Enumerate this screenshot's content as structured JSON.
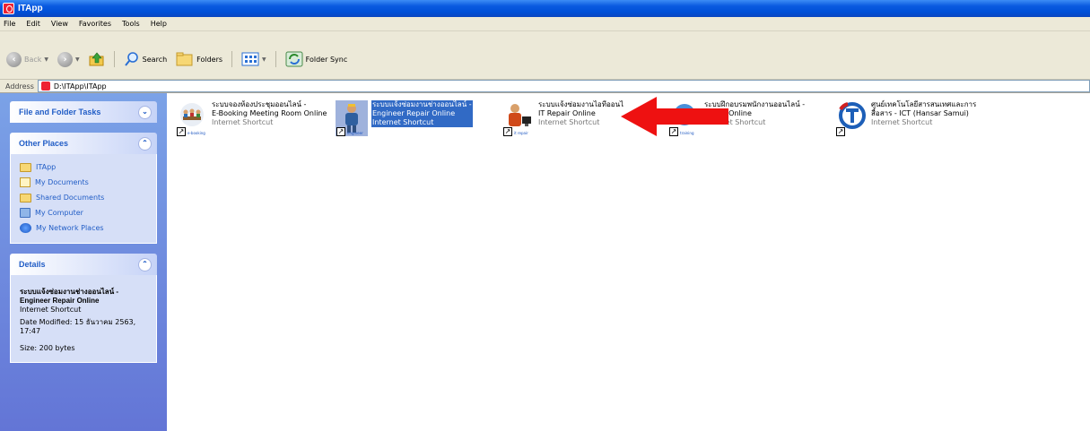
{
  "window": {
    "title": "ITApp"
  },
  "menu": [
    "File",
    "Edit",
    "View",
    "Favorites",
    "Tools",
    "Help"
  ],
  "toolbar": {
    "back": "Back",
    "search": "Search",
    "folders": "Folders",
    "folder_sync": "Folder Sync"
  },
  "address": {
    "label": "Address",
    "value": "D:\\ITApp\\ITApp"
  },
  "sidebar": {
    "file_tasks": {
      "title": "File and Folder Tasks"
    },
    "other_places": {
      "title": "Other Places",
      "items": [
        "ITApp",
        "My Documents",
        "Shared Documents",
        "My Computer",
        "My Network Places"
      ]
    },
    "details": {
      "title": "Details",
      "name_line1": "ระบบแจ้งซ่อมงานช่างออนไลน์ -",
      "name_line2": "Engineer Repair Online",
      "type": "Internet Shortcut",
      "modified": "Date Modified: 15 ธันวาคม 2563, 17:47",
      "size": "Size: 200 bytes"
    }
  },
  "files": [
    {
      "line1": "ระบบจองห้องประชุมออนไลน์ -",
      "line2": "E-Booking Meeting Room Online",
      "type": "Internet Shortcut",
      "tag": "e-booking",
      "selected": false
    },
    {
      "line1": "ระบบแจ้งซ่อมงานช่างออนไลน์ -",
      "line2": "Engineer Repair Online",
      "type": "Internet Shortcut",
      "tag": "engineer",
      "selected": true
    },
    {
      "line1": "ระบบแจ้งซ่อมงานไอทีออนไ",
      "line2": "IT Repair Online",
      "type": "Internet Shortcut",
      "tag": "it repair",
      "selected": false
    },
    {
      "line1": "ระบบฝึกอบรมพนักงานออนไลน์ -",
      "line2": "aining Online",
      "type": "Internet Shortcut",
      "tag": "training",
      "selected": false
    },
    {
      "line1": "ศูนย์เทคโนโลยีสารสนเทศและการ",
      "line2": "สื่อสาร - ICT (Hansar Samui)",
      "type": "Internet Shortcut",
      "tag": "",
      "selected": false
    }
  ],
  "colors": {
    "title_bar": "#0a5ae0",
    "sidebar": "#7ba2e7",
    "selection": "#316ac5",
    "arrow": "#ee1111"
  }
}
